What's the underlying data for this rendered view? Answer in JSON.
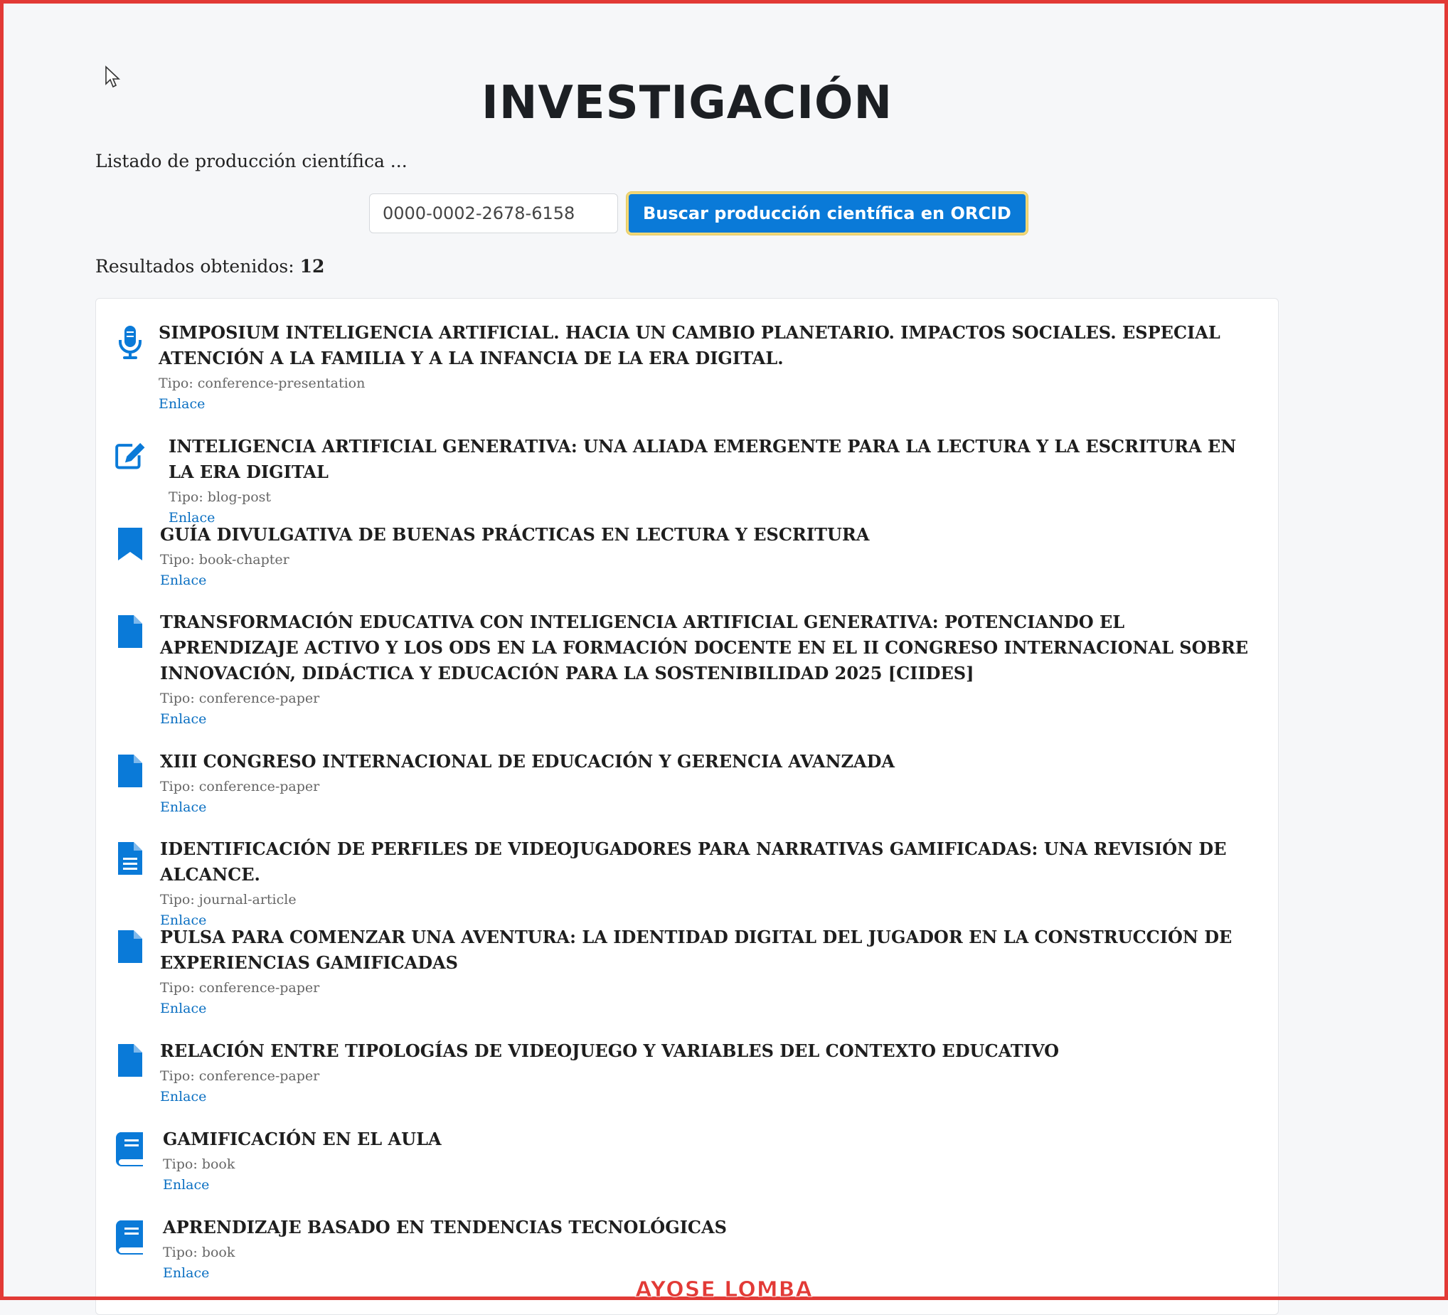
{
  "page": {
    "title": "INVESTIGACIÓN",
    "intro": "Listado de producción científica ...",
    "orcid_value": "0000-0002-2678-6158",
    "search_button": "Buscar producción científica en ORCID",
    "results_label": "Resultados obtenidos:",
    "results_count": "12",
    "watermark": "AYOSE LOMBA"
  },
  "colors": {
    "accent": "#0a7ad8",
    "frame": "#e23a36",
    "link": "#0a6fc2"
  },
  "items": [
    {
      "icon": "microphone-icon",
      "title": "SIMPOSIUM INTELIGENCIA ARTIFICIAL. HACIA UN CAMBIO PLANETARIO. IMPACTOS SOCIALES. ESPECIAL ATENCIÓN A LA FAMILIA Y A LA INFANCIA DE LA ERA DIGITAL.",
      "type": "Tipo: conference-presentation",
      "link": "Enlace"
    },
    {
      "icon": "edit-icon",
      "title": "INTELIGENCIA ARTIFICIAL GENERATIVA: UNA ALIADA EMERGENTE PARA LA LECTURA Y LA ESCRITURA EN LA ERA DIGITAL",
      "type": "Tipo: blog-post",
      "link": "Enlace"
    },
    {
      "icon": "bookmark-icon",
      "title": "GUÍA DIVULGATIVA DE BUENAS PRÁCTICAS EN LECTURA Y ESCRITURA",
      "type": "Tipo: book-chapter",
      "link": "Enlace"
    },
    {
      "icon": "file-icon",
      "title": "TRANSFORMACIÓN EDUCATIVA CON INTELIGENCIA ARTIFICIAL GENERATIVA: POTENCIANDO EL APRENDIZAJE ACTIVO Y LOS ODS EN LA FORMACIÓN DOCENTE EN EL II CONGRESO INTERNACIONAL SOBRE INNOVACIÓN, DIDÁCTICA Y EDUCACIÓN PARA LA SOSTENIBILIDAD 2025 [CIIDES]",
      "type": "Tipo: conference-paper",
      "link": "Enlace"
    },
    {
      "icon": "file-icon",
      "title": "XIII CONGRESO INTERNACIONAL DE EDUCACIÓN Y GERENCIA AVANZADA",
      "type": "Tipo: conference-paper",
      "link": "Enlace"
    },
    {
      "icon": "file-text-icon",
      "title": "IDENTIFICACIÓN DE PERFILES DE VIDEOJUGADORES PARA NARRATIVAS GAMIFICADAS: UNA REVISIÓN DE ALCANCE.",
      "type": "Tipo: journal-article",
      "link": "Enlace"
    },
    {
      "icon": "file-icon",
      "title": "PULSA PARA COMENZAR UNA AVENTURA: LA IDENTIDAD DIGITAL DEL JUGADOR EN LA CONSTRUCCIÓN DE EXPERIENCIAS GAMIFICADAS",
      "type": "Tipo: conference-paper",
      "link": "Enlace"
    },
    {
      "icon": "file-icon",
      "title": "RELACIÓN ENTRE TIPOLOGÍAS DE VIDEOJUEGO Y VARIABLES DEL CONTEXTO EDUCATIVO",
      "type": "Tipo: conference-paper",
      "link": "Enlace"
    },
    {
      "icon": "book-icon",
      "title": "GAMIFICACIÓN EN EL AULA",
      "type": "Tipo: book",
      "link": "Enlace"
    },
    {
      "icon": "book-icon",
      "title": "APRENDIZAJE BASADO EN TENDENCIAS TECNOLÓGICAS",
      "type": "Tipo: book",
      "link": "Enlace"
    }
  ]
}
